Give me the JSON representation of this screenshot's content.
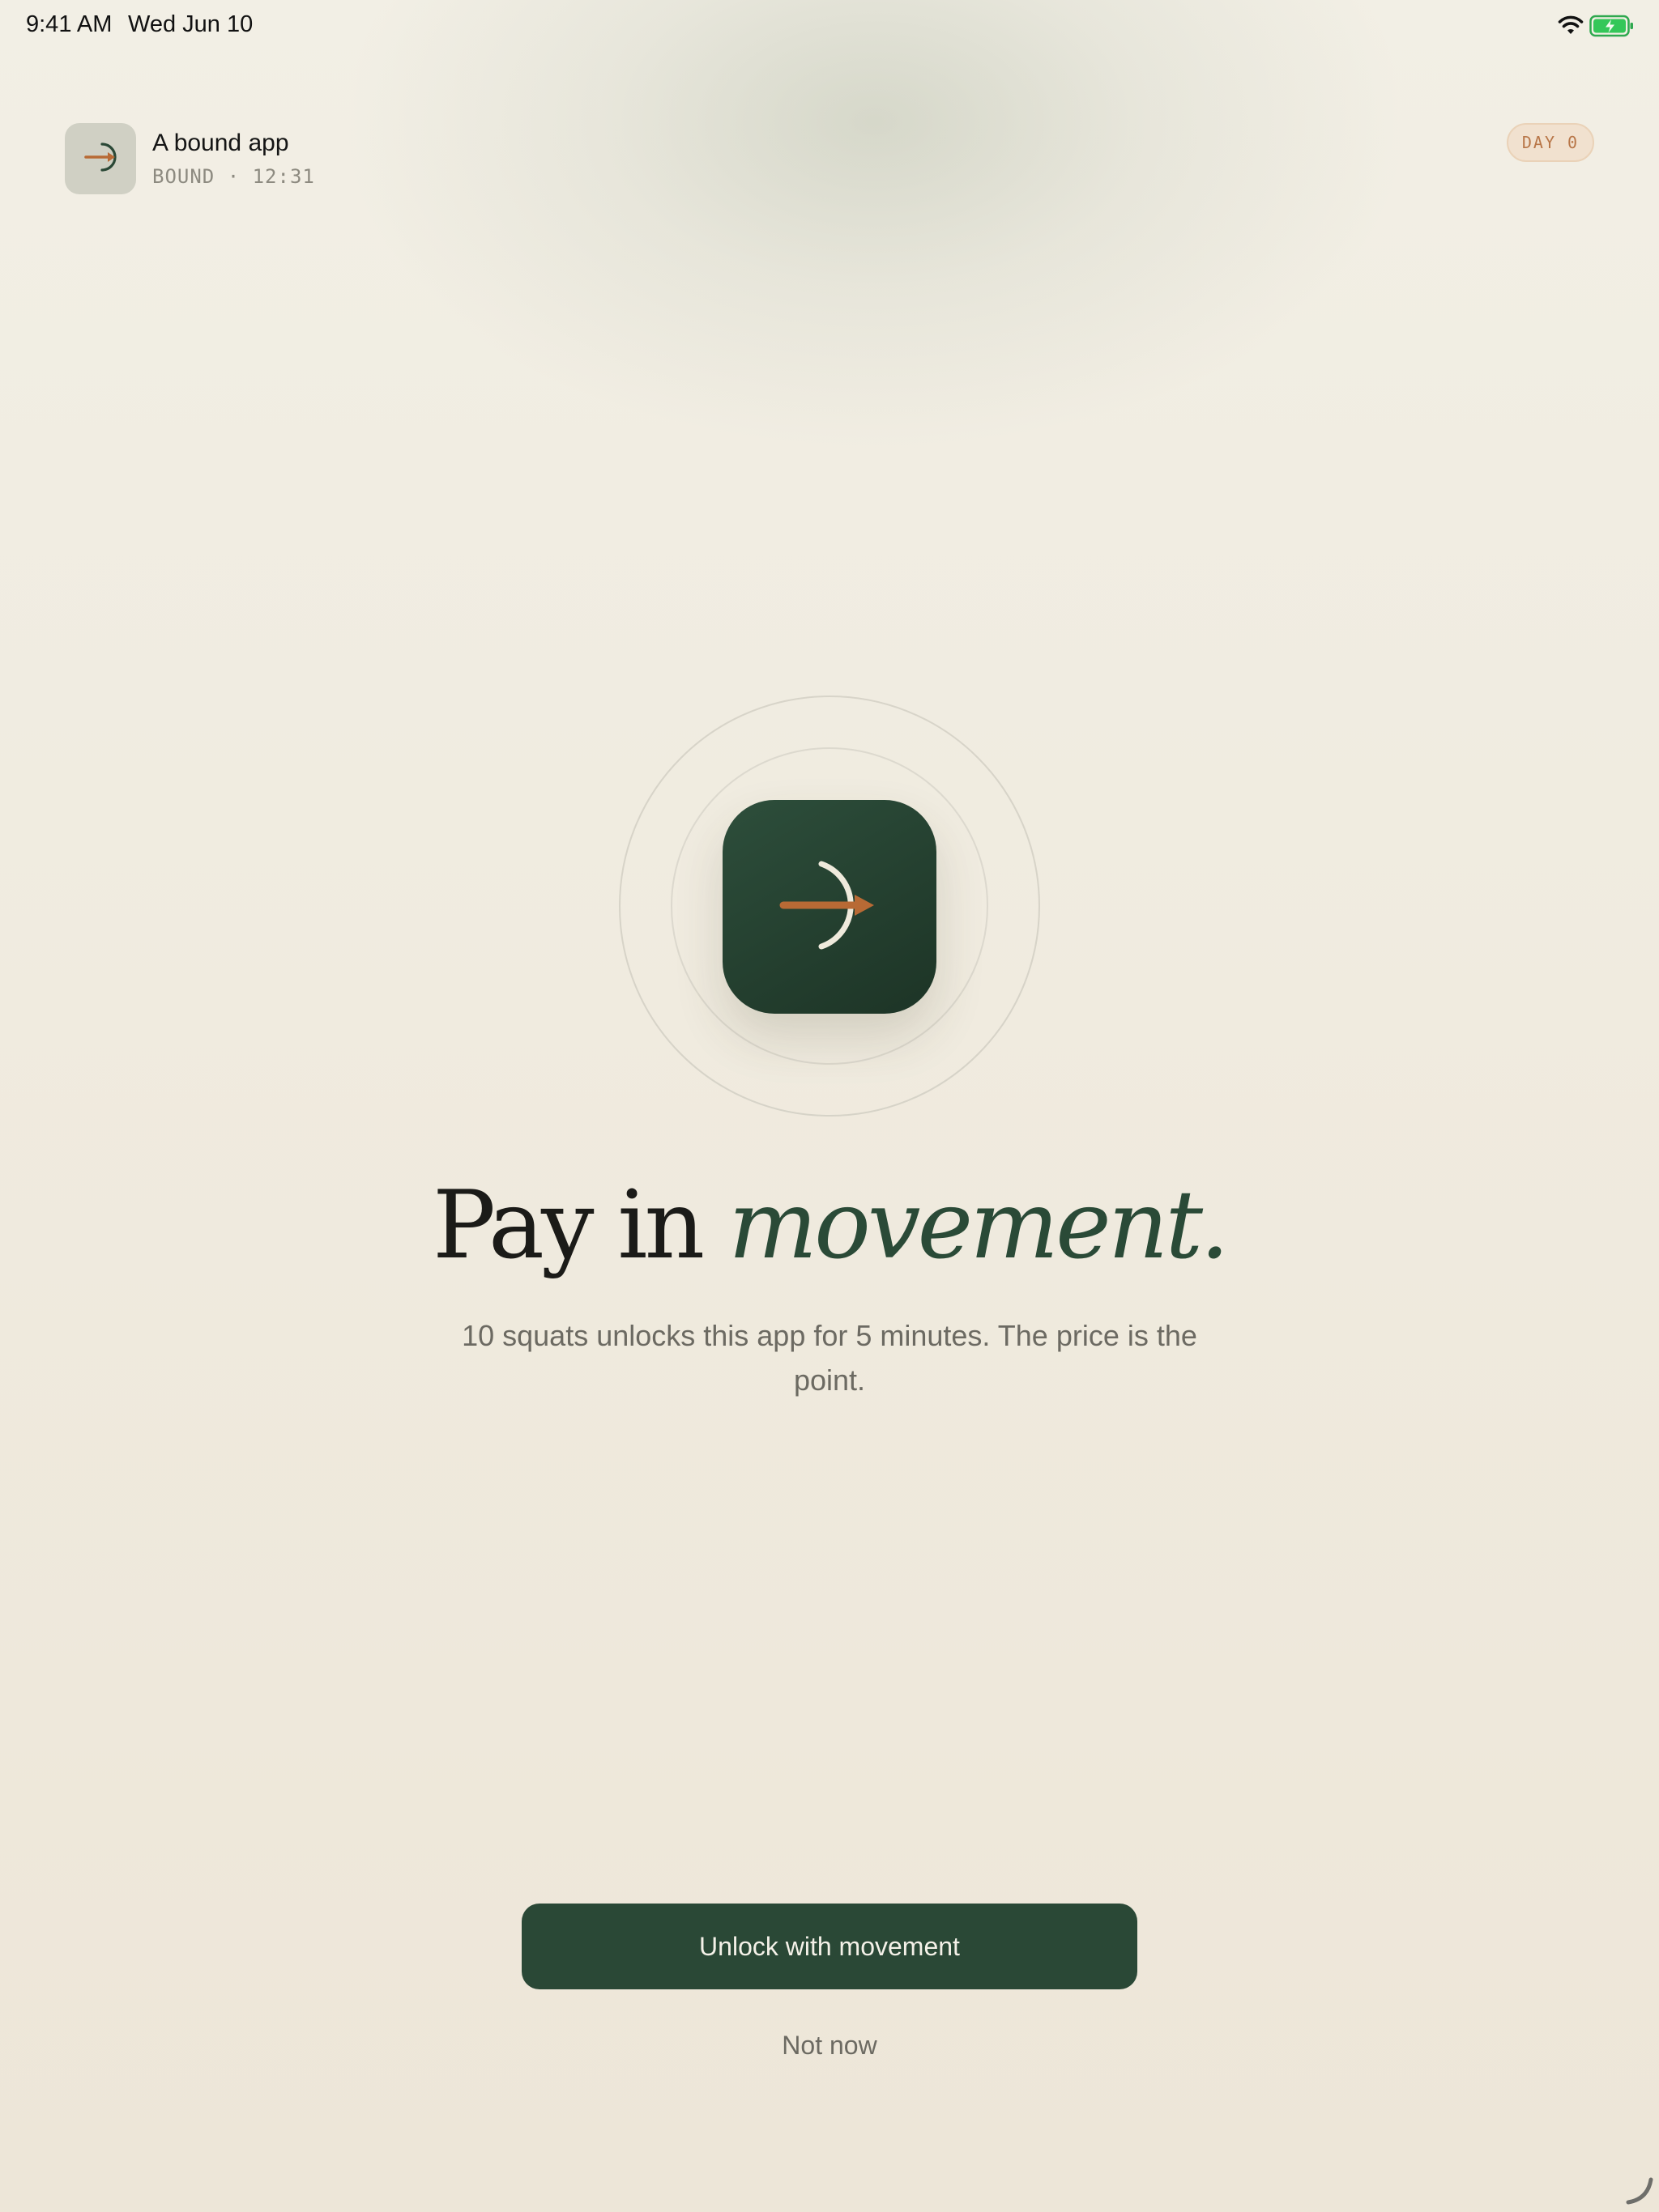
{
  "status_bar": {
    "time": "9:41 AM",
    "date": "Wed Jun 10",
    "icons": [
      "wifi-icon",
      "battery-charging-icon"
    ],
    "battery_color": "#34c759"
  },
  "app_header": {
    "name": "A bound app",
    "meta": "BOUND · 12:31",
    "icon": "arrow-right-icon",
    "day_badge": "DAY 0"
  },
  "hero": {
    "icon": "bound-arrow-logo-icon",
    "headline_plain": "Pay in",
    "headline_accent": "movement.",
    "subtitle": "10 squats unlocks this app for 5 minutes. The price is the point."
  },
  "actions": {
    "primary_label": "Unlock with movement",
    "secondary_label": "Not now"
  },
  "colors": {
    "brand_green": "#2a4836",
    "accent_orange": "#b86a35",
    "background": "#f2efe5"
  }
}
